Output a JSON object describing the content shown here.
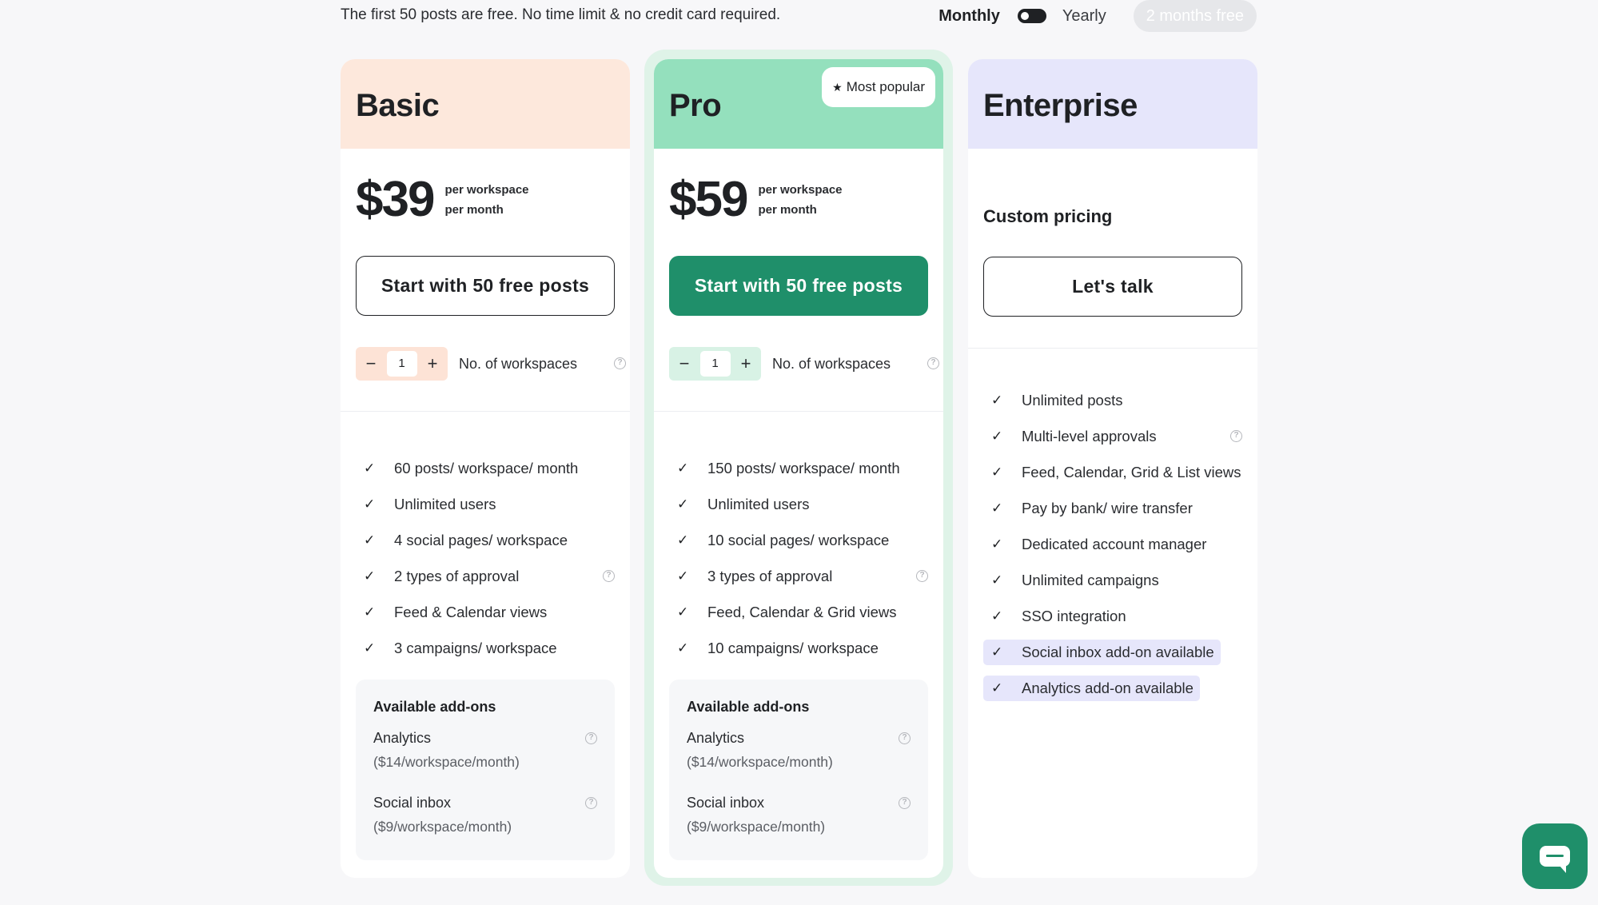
{
  "top": {
    "note": "The first 50 posts are free. No time limit & no credit card required.",
    "monthly": "Monthly",
    "yearly": "Yearly",
    "save_badge": "2 months free"
  },
  "plans": {
    "basic": {
      "name": "Basic",
      "price": "$39",
      "per_line1": "per workspace",
      "per_line2": "per month",
      "cta": "Start with 50 free posts",
      "workspaces_value": "1",
      "workspaces_label": "No. of workspaces",
      "features": [
        "60 posts/ workspace/ month",
        "Unlimited users",
        "4 social pages/ workspace",
        "2 types of approval",
        "Feed & Calendar views",
        "3 campaigns/ workspace"
      ],
      "addons_title": "Available add-ons",
      "addons": [
        {
          "name": "Analytics",
          "price": "($14/workspace/month)"
        },
        {
          "name": "Social inbox",
          "price": "($9/workspace/month)"
        }
      ]
    },
    "pro": {
      "name": "Pro",
      "badge": "Most popular",
      "price": "$59",
      "per_line1": "per workspace",
      "per_line2": "per month",
      "cta": "Start with 50 free posts",
      "workspaces_value": "1",
      "workspaces_label": "No. of workspaces",
      "features": [
        "150 posts/ workspace/ month",
        "Unlimited users",
        "10 social pages/ workspace",
        "3 types of approval",
        "Feed, Calendar & Grid views",
        "10 campaigns/ workspace"
      ],
      "addons_title": "Available add-ons",
      "addons": [
        {
          "name": "Analytics",
          "price": "($14/workspace/month)"
        },
        {
          "name": "Social inbox",
          "price": "($9/workspace/month)"
        }
      ]
    },
    "enterprise": {
      "name": "Enterprise",
      "custom_pricing": "Custom pricing",
      "cta": "Let's talk",
      "features": [
        "Unlimited posts",
        "Multi-level approvals",
        "Feed, Calendar, Grid & List views",
        "Pay by bank/ wire transfer",
        "Dedicated account manager",
        "Unlimited campaigns",
        "SSO integration",
        "Social inbox add-on available",
        "Analytics add-on available"
      ]
    }
  },
  "colors": {
    "basic_header": "#fde8dc",
    "pro_header": "#94e0bd",
    "enterprise_header": "#e6e6fb",
    "accent_green": "#1f8f6a"
  },
  "icons": {
    "check": "check-icon",
    "help": "help-circle-icon",
    "star": "star-icon",
    "chat": "chat-icon"
  }
}
